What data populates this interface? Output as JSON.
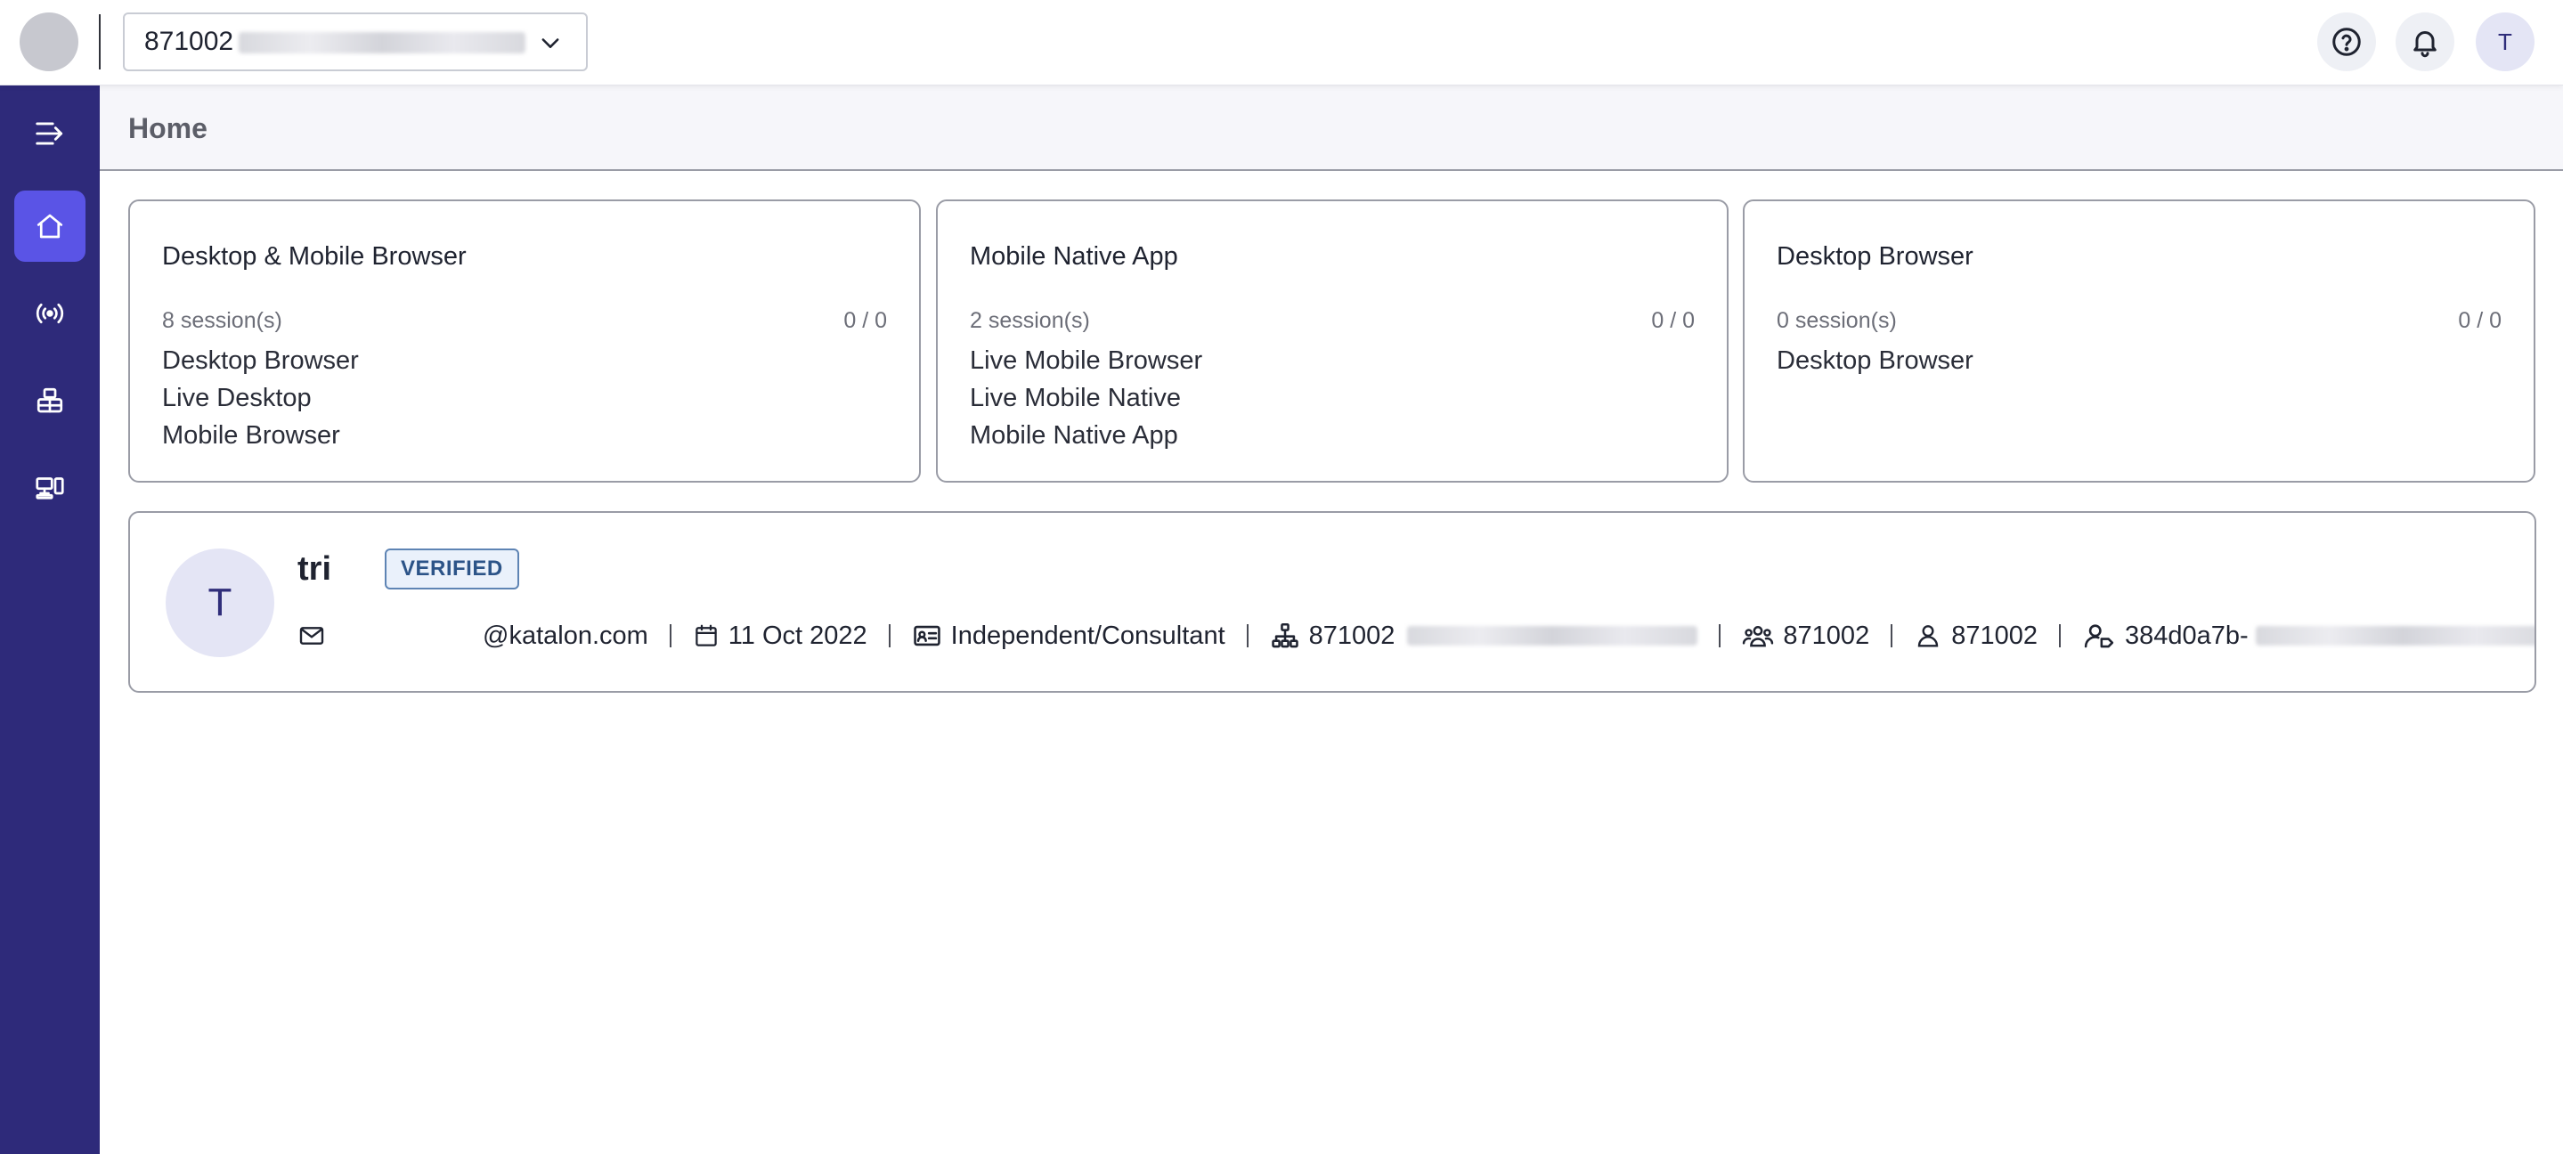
{
  "header": {
    "org_id": "871002",
    "user_initial": "T"
  },
  "page": {
    "title": "Home"
  },
  "cards": [
    {
      "title": "Desktop & Mobile Browser",
      "sessions": "8 session(s)",
      "ratio": "0 / 0",
      "items": [
        "Desktop Browser",
        "Live Desktop",
        "Mobile Browser"
      ]
    },
    {
      "title": "Mobile Native App",
      "sessions": "2 session(s)",
      "ratio": "0 / 0",
      "items": [
        "Live Mobile Browser",
        "Live Mobile Native",
        "Mobile Native App"
      ]
    },
    {
      "title": "Desktop Browser",
      "sessions": "0 session(s)",
      "ratio": "0 / 0",
      "items": [
        "Desktop Browser"
      ]
    }
  ],
  "profile": {
    "initial": "T",
    "name": "tri",
    "badge": "VERIFIED",
    "email": "@katalon.com",
    "joined": "11 Oct 2022",
    "role": "Independent/Consultant",
    "organization": "871002",
    "team": "871002",
    "account": "871002",
    "user_id": "384d0a7b-"
  },
  "icons": {
    "logo": "app-logo",
    "select": "chevron-down-icon",
    "help": "help-circle-icon",
    "notifications": "bell-icon",
    "sidebar": [
      "collapse-menu-icon",
      "home-icon",
      "broadcast-icon",
      "robot-icon",
      "devices-icon"
    ]
  },
  "colors": {
    "sidebar_bg": "#2e2a7a",
    "sidebar_active": "#5a54e6",
    "verified_bg": "#eaf1fb",
    "verified_text": "#2c5488"
  }
}
